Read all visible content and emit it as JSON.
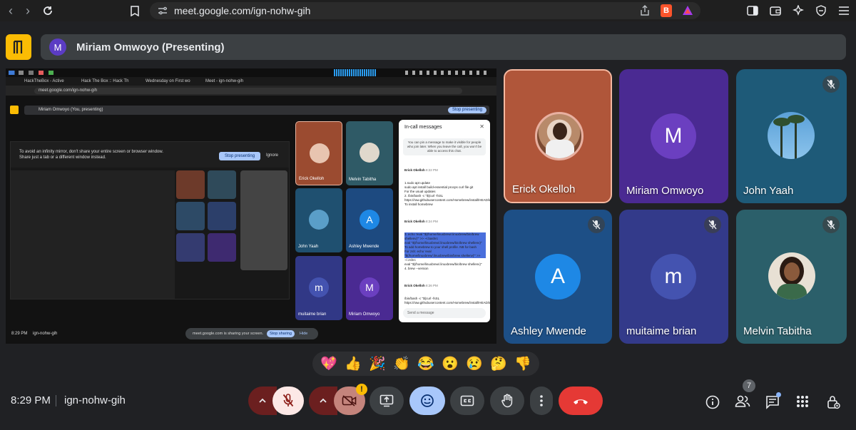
{
  "browser": {
    "url": "meet.google.com/ign-nohw-gih",
    "brave_label": "B"
  },
  "meeting": {
    "presenter_initial": "M",
    "presenter_label": "Miriam Omwoyo (Presenting)",
    "time": "8:29 PM",
    "code": "ign-nohw-gih",
    "people_count": "7"
  },
  "participants": [
    {
      "name": "Erick Okelloh",
      "initial": "",
      "muted": false,
      "bg": "#b0563a",
      "photo": "person-photo"
    },
    {
      "name": "Miriam Omwoyo",
      "initial": "M",
      "muted": false,
      "bg": "#4a2a92",
      "avatar_color": "#6b3fc0"
    },
    {
      "name": "John Yaah",
      "initial": "",
      "muted": true,
      "bg": "#1e5a78",
      "photo": "palm-trees-photo"
    },
    {
      "name": "Ashley Mwende",
      "initial": "A",
      "muted": true,
      "bg": "#1d4f86",
      "avatar_color": "#1e88e5"
    },
    {
      "name": "muitaime brian",
      "initial": "m",
      "muted": true,
      "bg": "#333a8a",
      "avatar_color": "#4453b0"
    },
    {
      "name": "Melvin Tabitha",
      "initial": "",
      "muted": true,
      "bg": "#2b5f6a",
      "photo": "person-photo"
    }
  ],
  "share": {
    "tabs": [
      "HackTheBox - Active",
      "Hack The Box :: Hack Th",
      "Wednesday on First wo",
      "Meet - ign-nohw-gih"
    ],
    "inner_url": "meet.google.com/ign-nohw-gih",
    "inner_presenter": "Miriam Omwoyo (You, presenting)",
    "stop_presenting": "Stop presenting",
    "warning": "To avoid an infinity mirror, don't share your entire screen or browser window. Share just a tab or a different window instead.",
    "warning_btn": "Stop presenting",
    "ignore": "Ignore",
    "inner_tiles": [
      {
        "name": "Erick Okelloh",
        "initial": ""
      },
      {
        "name": "Melvin Tabitha",
        "initial": ""
      },
      {
        "name": "John Yaah",
        "initial": ""
      },
      {
        "name": "Ashley Mwende",
        "initial": "A"
      },
      {
        "name": "muitaime brian",
        "initial": "m"
      },
      {
        "name": "Miriam Omwoyo",
        "initial": "M"
      }
    ],
    "chat_title": "In-call messages",
    "chat_notice": "You can pin a message to make it visible for people who join later. When you leave the call, you won't be able to access this chat.",
    "chat_msgs": [
      {
        "sender": "Erick Okelloh",
        "time": "8:22 PM",
        "body": "1.sudo apt update\nsudo apt install build-essential procps curl file git\nFor the usual updates\n2. /bin/bash -c \"$(curl -fsSL https://raw.githubusercontent.com/Homebrew/install/HEAD/install.sh)\"\nTo install homebrew"
      },
      {
        "sender": "Erick Okelloh",
        "time": "8:24 PM",
        "body": "3. echo 'eval \"$(/home/linuxbrew/.linuxbrew/bin/brew shellenv)\"' >> ~/.bashrc\neval \"$(/home/linuxbrew/.linuxbrew/bin/brew shellenv)\"\nTo add homebrew to your shell profile. NB for bash\nFor zsh: echo 'eval \"$(/home/linuxbrew/.linuxbrew/bin/brew shellenv)\"' >> ~/.zshrc\neval \"$(/home/linuxbrew/.linuxbrew/bin/brew shellenv)\"\n4. brew --version"
      },
      {
        "sender": "Erick Okelloh",
        "time": "8:26 PM",
        "body": "/bin/bash -c \"$(curl -fsSL https://raw.githubusercontent.com/Homebrew/install/HEAD/install.sh)\""
      }
    ],
    "chat_input": "Send a message",
    "footer_time": "8:29 PM",
    "footer_code": "ign-nohw-gih",
    "sharing_notice": "meet.google.com is sharing your screen.",
    "stop_sharing": "Stop sharing",
    "hide": "Hide"
  },
  "reactions": [
    "💖",
    "👍",
    "🎉",
    "👏",
    "😂",
    "😮",
    "😢",
    "🤔",
    "👎"
  ],
  "colors": {
    "end_call": "#e53935",
    "mic_off": "#fce8e6",
    "dark_red": "#6b1f1f",
    "reaction_active": "#a8c7fa"
  }
}
